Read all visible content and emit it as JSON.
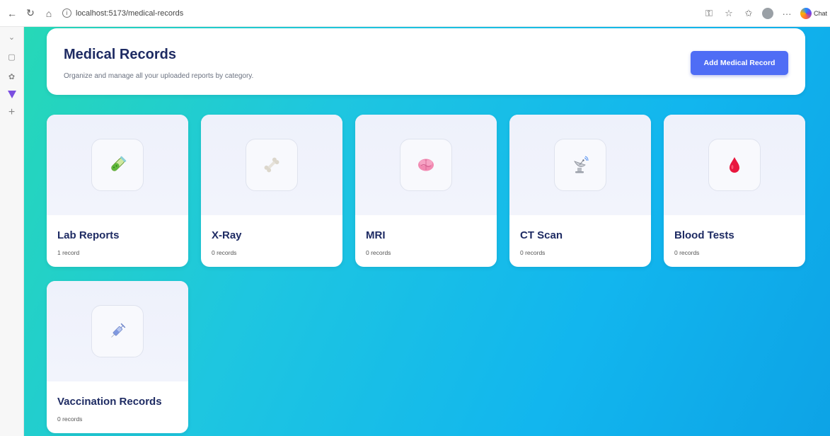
{
  "browser": {
    "url": "localhost:5173/medical-records",
    "copilot_label": "Chat"
  },
  "header": {
    "title": "Medical Records",
    "subtitle": "Organize and manage all your uploaded reports by category.",
    "add_button_label": "Add Medical Record"
  },
  "categories": [
    {
      "title": "Lab Reports",
      "count": "1 record",
      "icon": "test-tube-icon"
    },
    {
      "title": "X-Ray",
      "count": "0 records",
      "icon": "bone-icon"
    },
    {
      "title": "MRI",
      "count": "0 records",
      "icon": "brain-icon"
    },
    {
      "title": "CT Scan",
      "count": "0 records",
      "icon": "satellite-dish-icon"
    },
    {
      "title": "Blood Tests",
      "count": "0 records",
      "icon": "blood-drop-icon"
    },
    {
      "title": "Vaccination Records",
      "count": "0 records",
      "icon": "syringe-icon"
    }
  ],
  "colors": {
    "accent": "#4f6df5",
    "title": "#1e2b63",
    "background_start": "#26d8b7",
    "background_end": "#0da3e6"
  }
}
